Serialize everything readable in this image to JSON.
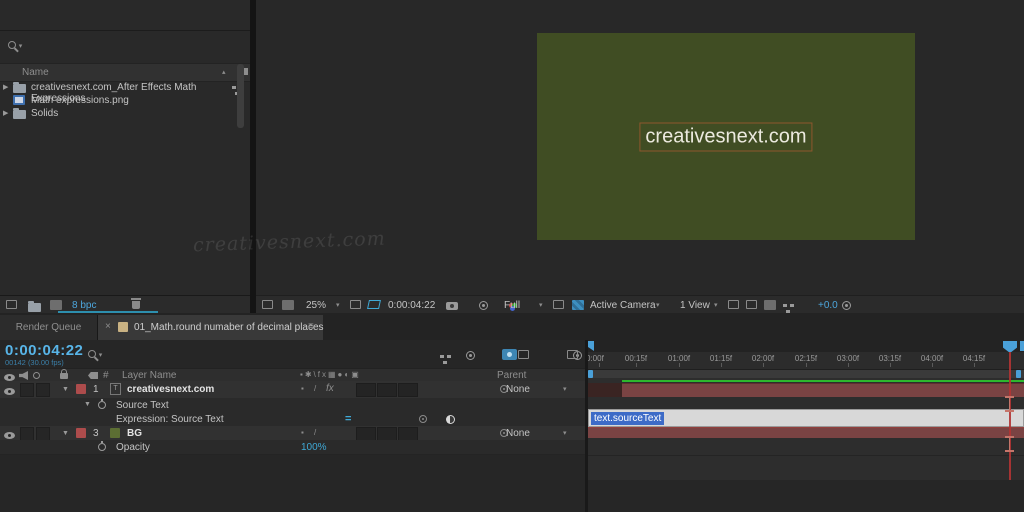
{
  "project": {
    "columns": {
      "name": "Name"
    },
    "items": [
      {
        "label": "creativesnext.com_After Effects Math Expressions",
        "type": "folder"
      },
      {
        "label": "Math expressions.png",
        "type": "footage"
      },
      {
        "label": "Solids",
        "type": "folder"
      }
    ],
    "bit_depth": "8 bpc"
  },
  "watermark": "creativesnext.com",
  "viewer": {
    "comp_text": "creativesnext.com",
    "toolbar": {
      "zoom": "25%",
      "timecode": "0:00:04:22",
      "resolution": "Full",
      "camera": "Active Camera",
      "views": "1 View",
      "exposure": "+0.0"
    }
  },
  "tabs": {
    "render_queue": "Render Queue",
    "comp_tab": "01_Math.round numaber of decimal places"
  },
  "timeline": {
    "timecode": "0:00:04:22",
    "frame_info": "00142 (30.00 fps)",
    "header": {
      "hash": "#",
      "layer_name": "Layer Name",
      "parent": "Parent"
    },
    "rows": {
      "layer1": {
        "index": "1",
        "name": "creativesnext.com"
      },
      "prop_source_text": "Source Text",
      "prop_expression": "Expression: Source Text",
      "expr_equals": "=",
      "layer3": {
        "index": "3",
        "name": "BG"
      },
      "prop_opacity": "Opacity",
      "opacity_value": "100%",
      "parent_value": "None"
    },
    "expression_field": "text.sourceText",
    "ruler": [
      "0:00f",
      "00:15f",
      "01:00f",
      "01:15f",
      "02:00f",
      "02:15f",
      "03:00f",
      "03:15f",
      "04:00f",
      "04:15f"
    ]
  },
  "colors": {
    "accent_blue": "#4da6dc",
    "value_cyan": "#3fa9d6",
    "comp_bg": "#404d23",
    "layer_bar_red": "#7a4343",
    "work_area_green": "#2db82d",
    "label_red": "#ad4c4c",
    "bg_swatch_green": "#5c6e33",
    "playhead_red": "#b03434",
    "selection_blue": "#3d6bc7",
    "comp_tab_swatch": "#c9b283"
  }
}
